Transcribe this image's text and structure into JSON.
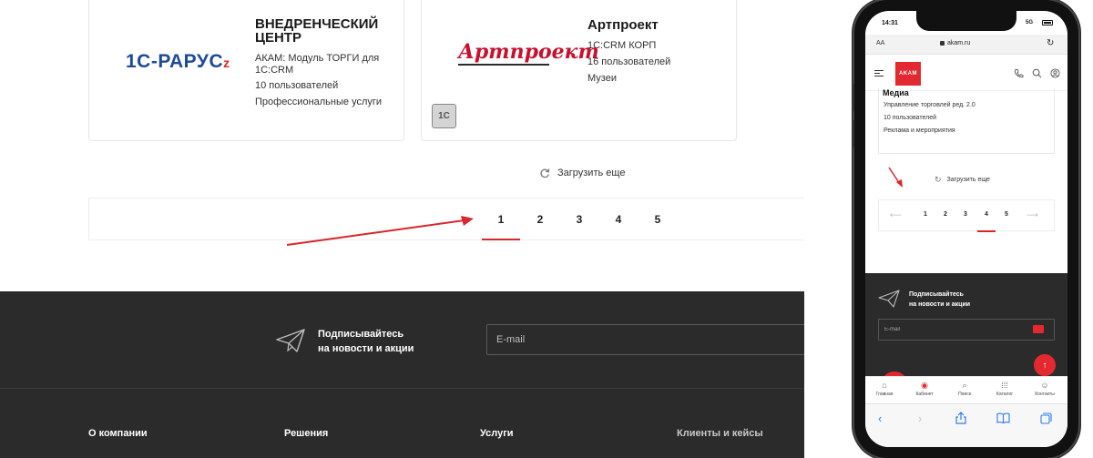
{
  "desktop": {
    "cards": [
      {
        "logo": "1С-РАРУС",
        "title_line1": "ВНЕДРЕНЧЕСКИЙ",
        "title_line2": "ЦЕНТР",
        "lines": [
          "АКАМ: Модуль ТОРГИ для",
          "1С:CRM",
          "10 пользователей",
          "Профессиональные услуги"
        ]
      },
      {
        "logo": "Артпроект",
        "title_line1": "Артпроект",
        "lines": [
          "1С:CRM КОРП",
          "16 пользователей",
          "Музеи"
        ],
        "badge": "1С"
      }
    ],
    "load_more": "Загрузить еще",
    "pages": [
      "1",
      "2",
      "3",
      "4",
      "5"
    ],
    "active_page": "1",
    "subscribe": {
      "line1": "Подписывайтесь",
      "line2": "на новости и акции",
      "email_placeholder": "E-mail"
    },
    "footer": {
      "columns": [
        "О компании",
        "Решения",
        "Услуги",
        "Клиенты и кейсы"
      ]
    }
  },
  "phone": {
    "status_time": "14:31",
    "status_net": "5G",
    "url_aa": "AA",
    "url": "akam.ru",
    "logo": "AKAM",
    "card": {
      "title": "Медиа",
      "lines": [
        "Управление торговлей ред. 2.0",
        "10 пользователей",
        "Реклама и мероприятия"
      ]
    },
    "load_more": "Загрузить еще",
    "pages": [
      "1",
      "2",
      "3",
      "4",
      "5"
    ],
    "active_page": "4",
    "subscribe": {
      "line1": "Подписывайтесь",
      "line2": "на новости и акции",
      "email_placeholder": "E-mail"
    },
    "tabs": [
      {
        "icon": "home-icon",
        "label": "Главная"
      },
      {
        "icon": "cabinet-icon",
        "label": "Кабинет"
      },
      {
        "icon": "search-icon",
        "label": "Поиск"
      },
      {
        "icon": "catalog-icon",
        "label": "Каталог"
      },
      {
        "icon": "contacts-icon",
        "label": "Контакты"
      }
    ]
  },
  "colors": {
    "accent": "#e3292f",
    "dark": "#2b2b2b",
    "arrow": "#d9262c",
    "rarus_blue": "#1e4a9a"
  }
}
